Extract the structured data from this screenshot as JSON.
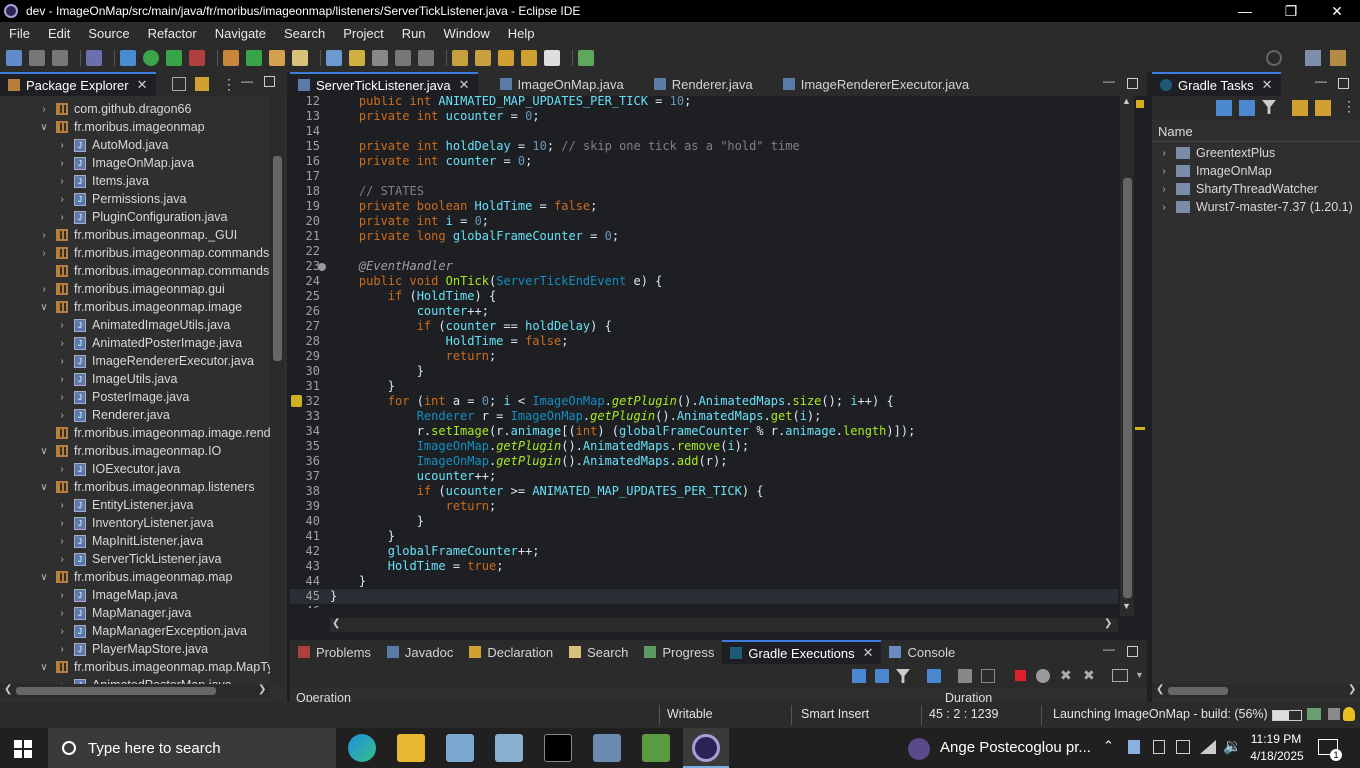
{
  "window": {
    "title": "dev - ImageOnMap/src/main/java/fr/moribus/imageonmap/listeners/ServerTickListener.java - Eclipse IDE"
  },
  "menu": [
    "File",
    "Edit",
    "Source",
    "Refactor",
    "Navigate",
    "Search",
    "Project",
    "Run",
    "Window",
    "Help"
  ],
  "package_explorer": {
    "title": "Package Explorer",
    "items": [
      {
        "label": "com.github.dragon66",
        "depth": 1,
        "kind": "pkg",
        "open": false
      },
      {
        "label": "fr.moribus.imageonmap",
        "depth": 1,
        "kind": "pkg",
        "open": true
      },
      {
        "label": "AutoMod.java",
        "depth": 2,
        "kind": "java"
      },
      {
        "label": "ImageOnMap.java",
        "depth": 2,
        "kind": "java"
      },
      {
        "label": "Items.java",
        "depth": 2,
        "kind": "java"
      },
      {
        "label": "Permissions.java",
        "depth": 2,
        "kind": "java"
      },
      {
        "label": "PluginConfiguration.java",
        "depth": 2,
        "kind": "java"
      },
      {
        "label": "fr.moribus.imageonmap._GUI",
        "depth": 1,
        "kind": "pkg",
        "open": false
      },
      {
        "label": "fr.moribus.imageonmap.commands",
        "depth": 1,
        "kind": "pkg",
        "open": false
      },
      {
        "label": "fr.moribus.imageonmap.commands.",
        "depth": 1,
        "kind": "pkg",
        "open": null
      },
      {
        "label": "fr.moribus.imageonmap.gui",
        "depth": 1,
        "kind": "pkg",
        "open": false
      },
      {
        "label": "fr.moribus.imageonmap.image",
        "depth": 1,
        "kind": "pkg",
        "open": true
      },
      {
        "label": "AnimatedImageUtils.java",
        "depth": 2,
        "kind": "java"
      },
      {
        "label": "AnimatedPosterImage.java",
        "depth": 2,
        "kind": "java"
      },
      {
        "label": "ImageRendererExecutor.java",
        "depth": 2,
        "kind": "java"
      },
      {
        "label": "ImageUtils.java",
        "depth": 2,
        "kind": "java"
      },
      {
        "label": "PosterImage.java",
        "depth": 2,
        "kind": "java"
      },
      {
        "label": "Renderer.java",
        "depth": 2,
        "kind": "java"
      },
      {
        "label": "fr.moribus.imageonmap.image.rende",
        "depth": 1,
        "kind": "pkg",
        "open": null
      },
      {
        "label": "fr.moribus.imageonmap.IO",
        "depth": 1,
        "kind": "pkg",
        "open": true
      },
      {
        "label": "IOExecutor.java",
        "depth": 2,
        "kind": "java"
      },
      {
        "label": "fr.moribus.imageonmap.listeners",
        "depth": 1,
        "kind": "pkg",
        "open": true
      },
      {
        "label": "EntityListener.java",
        "depth": 2,
        "kind": "java"
      },
      {
        "label": "InventoryListener.java",
        "depth": 2,
        "kind": "java"
      },
      {
        "label": "MapInitListener.java",
        "depth": 2,
        "kind": "java"
      },
      {
        "label": "ServerTickListener.java",
        "depth": 2,
        "kind": "java"
      },
      {
        "label": "fr.moribus.imageonmap.map",
        "depth": 1,
        "kind": "pkg",
        "open": true
      },
      {
        "label": "ImageMap.java",
        "depth": 2,
        "kind": "java"
      },
      {
        "label": "MapManager.java",
        "depth": 2,
        "kind": "java"
      },
      {
        "label": "MapManagerException.java",
        "depth": 2,
        "kind": "java"
      },
      {
        "label": "PlayerMapStore.java",
        "depth": 2,
        "kind": "java"
      },
      {
        "label": "fr.moribus.imageonmap.map.MapTy",
        "depth": 1,
        "kind": "pkg",
        "open": true
      },
      {
        "label": "AnimatedPosterMap.java",
        "depth": 2,
        "kind": "java"
      }
    ]
  },
  "editor": {
    "tabs": [
      {
        "label": "ServerTickListener.java",
        "active": true
      },
      {
        "label": "ImageOnMap.java",
        "active": false
      },
      {
        "label": "Renderer.java",
        "active": false
      },
      {
        "label": "ImageRendererExecutor.java",
        "active": false
      }
    ],
    "lines": [
      {
        "n": "12",
        "t": "    public int ANIMATED_MAP_UPDATES_PER_TICK = 10;"
      },
      {
        "n": "13",
        "t": "    private int ucounter = 0;"
      },
      {
        "n": "14",
        "t": ""
      },
      {
        "n": "15",
        "t": "    private int holdDelay = 10; // skip one tick as a \"hold\" time"
      },
      {
        "n": "16",
        "t": "    private int counter = 0;"
      },
      {
        "n": "17",
        "t": ""
      },
      {
        "n": "18",
        "t": "    // STATES"
      },
      {
        "n": "19",
        "t": "    private boolean HoldTime = false;"
      },
      {
        "n": "20",
        "t": "    private int i = 0;"
      },
      {
        "n": "21",
        "t": "    private long globalFrameCounter = 0;"
      },
      {
        "n": "22",
        "t": ""
      },
      {
        "n": "23",
        "t": "    @EventHandler"
      },
      {
        "n": "24",
        "t": "    public void OnTick(ServerTickEndEvent e) {"
      },
      {
        "n": "25",
        "t": "        if (HoldTime) {"
      },
      {
        "n": "26",
        "t": "            counter++;"
      },
      {
        "n": "27",
        "t": "            if (counter == holdDelay) {"
      },
      {
        "n": "28",
        "t": "                HoldTime = false;"
      },
      {
        "n": "29",
        "t": "                return;"
      },
      {
        "n": "30",
        "t": "            }"
      },
      {
        "n": "31",
        "t": "        }"
      },
      {
        "n": "32",
        "t": "        for (int a = 0; i < ImageOnMap.getPlugin().AnimatedMaps.size(); i++) {"
      },
      {
        "n": "33",
        "t": "            Renderer r = ImageOnMap.getPlugin().AnimatedMaps.get(i);"
      },
      {
        "n": "34",
        "t": "            r.setImage(r.animage[(int) (globalFrameCounter % r.animage.length)]);"
      },
      {
        "n": "35",
        "t": "            ImageOnMap.getPlugin().AnimatedMaps.remove(i);"
      },
      {
        "n": "36",
        "t": "            ImageOnMap.getPlugin().AnimatedMaps.add(r);"
      },
      {
        "n": "37",
        "t": "            ucounter++;"
      },
      {
        "n": "38",
        "t": "            if (ucounter >= ANIMATED_MAP_UPDATES_PER_TICK) {"
      },
      {
        "n": "39",
        "t": "                return;"
      },
      {
        "n": "40",
        "t": "            }"
      },
      {
        "n": "41",
        "t": "        }"
      },
      {
        "n": "42",
        "t": "        globalFrameCounter++;"
      },
      {
        "n": "43",
        "t": "        HoldTime = true;"
      },
      {
        "n": "44",
        "t": "    }"
      },
      {
        "n": "45",
        "t": "}"
      },
      {
        "n": "46",
        "t": ""
      }
    ]
  },
  "gradle_tasks": {
    "title": "Gradle Tasks",
    "column": "Name",
    "projects": [
      "GreentextPlus",
      "ImageOnMap",
      "ShartyThreadWatcher",
      "Wurst7-master-7.37 (1.20.1)"
    ]
  },
  "bottom_panel": {
    "tabs": [
      {
        "label": "Problems",
        "active": false
      },
      {
        "label": "Javadoc",
        "active": false
      },
      {
        "label": "Declaration",
        "active": false
      },
      {
        "label": "Search",
        "active": false
      },
      {
        "label": "Progress",
        "active": false
      },
      {
        "label": "Gradle Executions",
        "active": true
      },
      {
        "label": "Console",
        "active": false
      }
    ],
    "col_operation": "Operation",
    "col_duration": "Duration"
  },
  "status": {
    "writable": "Writable",
    "insert_mode": "Smart Insert",
    "position": "45 : 2 : 1239",
    "job": "Launching ImageOnMap - build: (56%)",
    "job_progress": 0.56
  },
  "taskbar": {
    "search_placeholder": "Type here to search",
    "notification": "Ange Postecoglou pr...",
    "time": "11:19 PM",
    "date": "4/18/2025",
    "notif_count": "1"
  },
  "colors": {
    "accent": "#3d7dde",
    "keyword": "#cc6c1d",
    "field": "#66e1f8"
  }
}
